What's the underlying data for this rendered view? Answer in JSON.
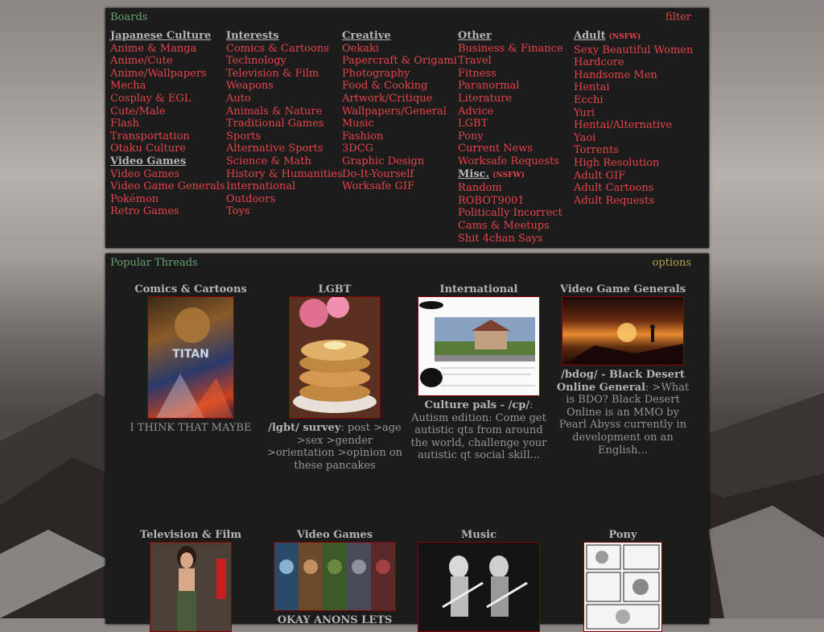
{
  "boards": {
    "title": "Boards",
    "filter_label": "filter",
    "columns": [
      {
        "sections": [
          {
            "heading": "Japanese Culture",
            "items": [
              "Anime & Manga",
              "Anime/Cute",
              "Anime/Wallpapers",
              "Mecha",
              "Cosplay & EGL",
              "Cute/Male",
              "Flash",
              "Transportation",
              "Otaku Culture"
            ]
          },
          {
            "heading": "Video Games",
            "items": [
              "Video Games",
              "Video Game Generals",
              "Pokémon",
              "Retro Games"
            ]
          }
        ]
      },
      {
        "sections": [
          {
            "heading": "Interests",
            "items": [
              "Comics & Cartoons",
              "Technology",
              "Television & Film",
              "Weapons",
              "Auto",
              "Animals & Nature",
              "Traditional Games",
              "Sports",
              "Alternative Sports",
              "Science & Math",
              "History & Humanities",
              "International",
              "Outdoors",
              "Toys"
            ]
          }
        ]
      },
      {
        "sections": [
          {
            "heading": "Creative",
            "items": [
              "Oekaki",
              "Papercraft & Origami",
              "Photography",
              "Food & Cooking",
              "Artwork/Critique",
              "Wallpapers/General",
              "Music",
              "Fashion",
              "3DCG",
              "Graphic Design",
              "Do-It-Yourself",
              "Worksafe GIF"
            ]
          }
        ]
      },
      {
        "sections": [
          {
            "heading": "Other",
            "items": [
              "Business & Finance",
              "Travel",
              "Fitness",
              "Paranormal",
              "Literature",
              "Advice",
              "LGBT",
              "Pony",
              "Current News",
              "Worksafe Requests"
            ]
          },
          {
            "heading": "Misc.",
            "tag": "(NSFW)",
            "items": [
              "Random",
              "ROBOT9001",
              "Politically Incorrect",
              "Cams & Meetups",
              "Shit 4chan Says"
            ]
          }
        ]
      },
      {
        "sections": [
          {
            "heading": "Adult",
            "tag": "(NSFW)",
            "items": [
              "Sexy Beautiful Women",
              "Hardcore",
              "Handsome Men",
              "Hentai",
              "Ecchi",
              "Yuri",
              "Hentai/Alternative",
              "Yaoi",
              "Torrents",
              "High Resolution",
              "Adult GIF",
              "Adult Cartoons",
              "Adult Requests"
            ]
          }
        ]
      }
    ]
  },
  "popular": {
    "title": "Popular Threads",
    "options_label": "options",
    "threads": [
      {
        "board": "Comics & Cartoons",
        "image": "titan-ae-poster",
        "subject": "",
        "teaser": "I THINK THAT MAYBE"
      },
      {
        "board": "LGBT",
        "image": "pancakes-photo",
        "subject": "/lgbt/ survey",
        "teaser": ": post >age >sex >gender >orientation >opinion on these pancakes"
      },
      {
        "board": "International",
        "image": "street-screenshot",
        "subject": "Culture pals - /cp/",
        "teaser": ": Autism edition: Come get autistic qts from around the world, challenge your autistic qt social skill..."
      },
      {
        "board": "Video Game Generals",
        "image": "sunset-figure",
        "subject": "/bdog/ - Black Desert Online General",
        "teaser": ": >What is BDO? Black Desert Online is an MMO by Pearl Abyss currently in development on an English..."
      },
      {
        "board": "Television & Film",
        "image": "woman-photo",
        "subject": "",
        "teaser": ""
      },
      {
        "board": "Video Games",
        "image": "game-characters",
        "subject": "",
        "teaser": "OKAY ANONS LETS"
      },
      {
        "board": "Music",
        "image": "concert-photo",
        "subject": "",
        "teaser": ""
      },
      {
        "board": "Pony",
        "image": "manga-page",
        "subject": "",
        "teaser": ""
      }
    ]
  }
}
